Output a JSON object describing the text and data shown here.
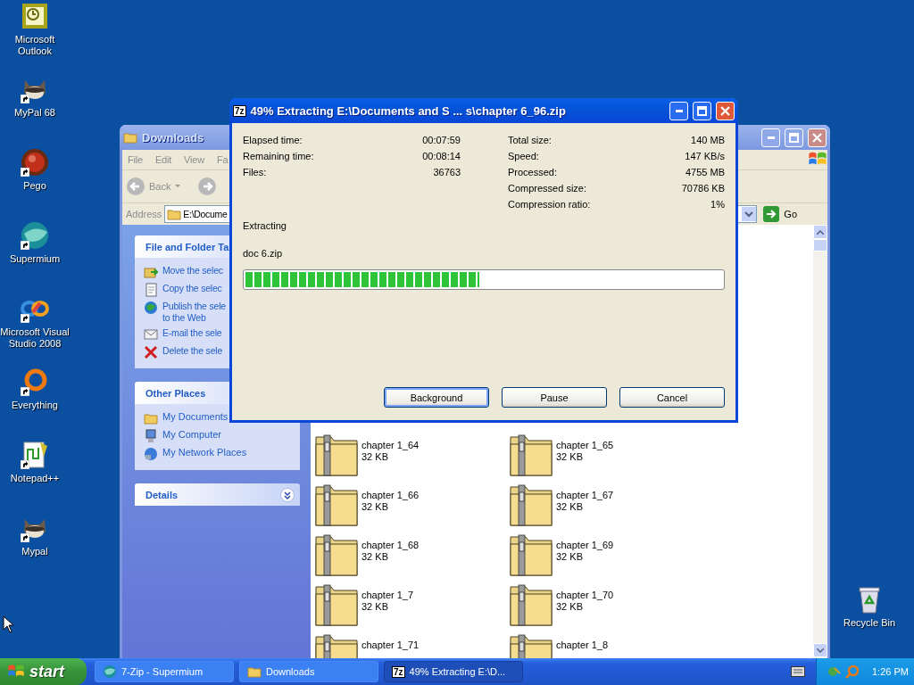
{
  "desktop_icons": [
    {
      "label": "Microsoft Outlook",
      "kind": "mail",
      "shortcut": false
    },
    {
      "label": "MyPal 68",
      "kind": "animal",
      "shortcut": true
    },
    {
      "label": "Pego",
      "kind": "ball",
      "shortcut": true
    },
    {
      "label": "Supermium",
      "kind": "globe",
      "shortcut": true
    },
    {
      "label": "Microsoft Visual Studio 2008",
      "kind": "infinity",
      "shortcut": true
    },
    {
      "label": "Everything",
      "kind": "ring",
      "shortcut": true
    },
    {
      "label": "Notepad++",
      "kind": "notepad",
      "shortcut": true
    },
    {
      "label": "Mypal",
      "kind": "animal",
      "shortcut": true
    }
  ],
  "recycle_bin": {
    "label": "Recycle Bin"
  },
  "explorer": {
    "title": "Downloads",
    "menu": [
      "File",
      "Edit",
      "View",
      "Fa"
    ],
    "back": "Back",
    "address_label": "Address",
    "address": "E:\\Docume",
    "go": "Go",
    "sidebar": [
      {
        "title": "File and Folder Ta",
        "items": [
          {
            "label": "Move the selec",
            "kind": "move"
          },
          {
            "label": "Copy the selec",
            "kind": "copy"
          },
          {
            "label": "Publish the sele\nto the Web",
            "kind": "publish"
          },
          {
            "label": "E-mail the sele",
            "kind": "email"
          },
          {
            "label": "Delete the sele",
            "kind": "delete"
          }
        ]
      },
      {
        "title": "Other Places",
        "items": [
          {
            "label": "My Documents",
            "kind": "folder"
          },
          {
            "label": "My Computer",
            "kind": "computer"
          },
          {
            "label": "My Network Places",
            "kind": "network"
          }
        ]
      },
      {
        "title": "Details",
        "expanded": false
      }
    ],
    "files": [
      {
        "name": "chapter 1_64",
        "size": "32 KB"
      },
      {
        "name": "chapter 1_65",
        "size": "32 KB"
      },
      {
        "name": "chapter 1_66",
        "size": "32 KB"
      },
      {
        "name": "chapter 1_67",
        "size": "32 KB"
      },
      {
        "name": "chapter 1_68",
        "size": "32 KB"
      },
      {
        "name": "chapter 1_69",
        "size": "32 KB"
      },
      {
        "name": "chapter 1_7",
        "size": "32 KB"
      },
      {
        "name": "chapter 1_70",
        "size": "32 KB"
      },
      {
        "name": "chapter 1_71"
      },
      {
        "name": "chapter 1_8"
      }
    ]
  },
  "dialog": {
    "app_badge": "7z",
    "title": "49% Extracting E:\\Documents and S ... s\\chapter 6_96.zip",
    "stats_left": [
      {
        "label": "Elapsed time:",
        "value": "00:07:59"
      },
      {
        "label": "Remaining time:",
        "value": "00:08:14"
      },
      {
        "label": "Files:",
        "value": "36763"
      }
    ],
    "stats_right": [
      {
        "label": "Total size:",
        "value": "140 MB"
      },
      {
        "label": "Speed:",
        "value": "147 KB/s"
      },
      {
        "label": "Processed:",
        "value": "4755 MB"
      },
      {
        "label": "Compressed size:",
        "value": "70786 KB"
      },
      {
        "label": "Compression ratio:",
        "value": "1%"
      }
    ],
    "status": "Extracting",
    "current_file": "doc 6.zip",
    "progress": {
      "level": 0.49
    },
    "buttons": [
      {
        "label": "Background",
        "focused": true
      },
      {
        "label": "Pause",
        "focused": false
      },
      {
        "label": "Cancel",
        "focused": false
      }
    ]
  },
  "taskbar": {
    "start": "start",
    "tasks": [
      {
        "label": "7-Zip - Supermium",
        "kind": "browser",
        "selected": false
      },
      {
        "label": "Downloads",
        "kind": "folder",
        "selected": false
      },
      {
        "label": "49% Extracting E:\\D...",
        "kind": "archive",
        "badge": "7z",
        "selected": true
      }
    ],
    "time": "1:26 PM"
  }
}
